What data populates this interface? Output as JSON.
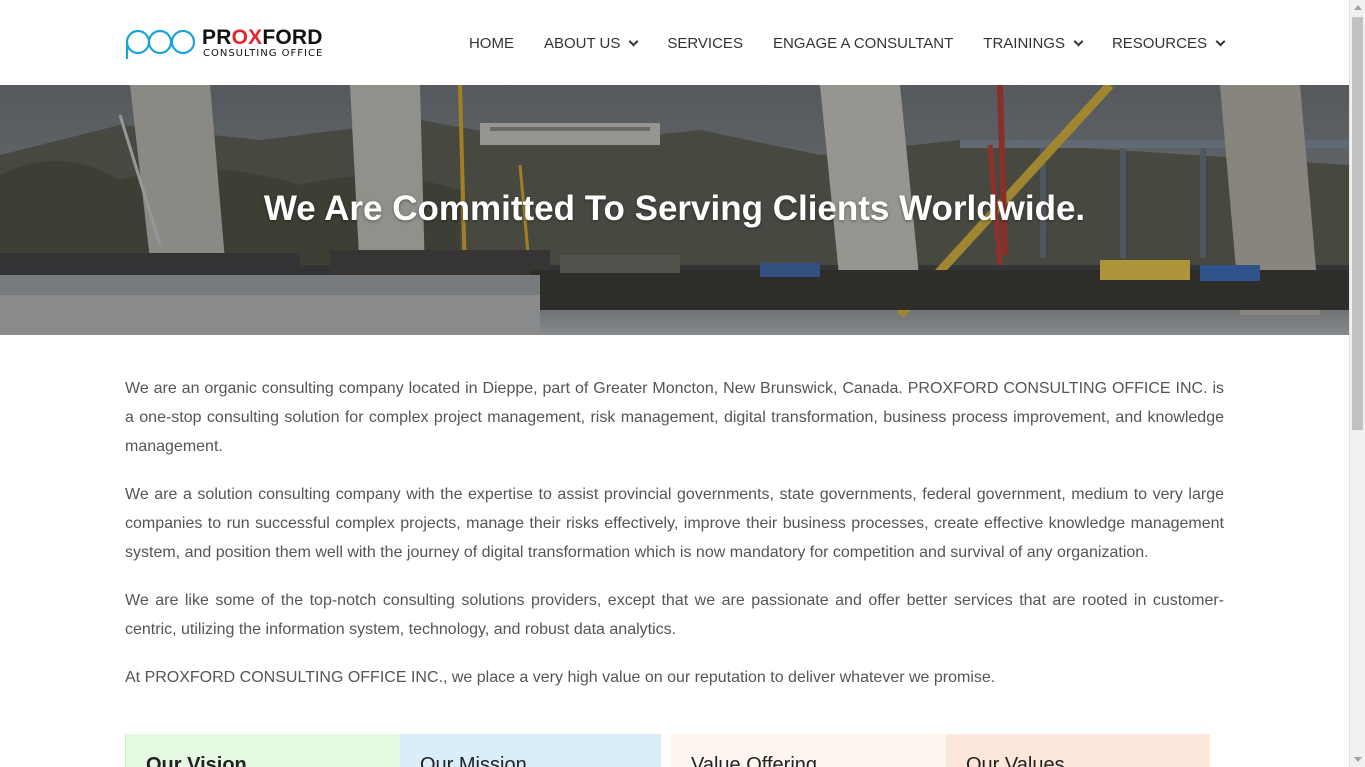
{
  "brand": {
    "name_part1": "PR",
    "name_accent": "OX",
    "name_part2": "FORD",
    "tagline": "CONSULTING OFFICE",
    "accent_color": "#e3262b",
    "mark_color": "#1aa3d9"
  },
  "nav": {
    "items": [
      {
        "label": "HOME",
        "has_dropdown": false
      },
      {
        "label": "ABOUT US",
        "has_dropdown": true
      },
      {
        "label": "SERVICES",
        "has_dropdown": false
      },
      {
        "label": "ENGAGE A CONSULTANT",
        "has_dropdown": false
      },
      {
        "label": "TRAININGS",
        "has_dropdown": true
      },
      {
        "label": "RESOURCES",
        "has_dropdown": true
      }
    ]
  },
  "hero": {
    "title": "We Are Committed To Serving Clients Worldwide."
  },
  "content": {
    "paragraphs": [
      "We are an organic consulting company located in Dieppe, part of Greater Moncton, New Brunswick, Canada. PROXFORD CONSULTING OFFICE INC. is a one-stop consulting solution for complex project management, risk management, digital transformation, business process improvement, and knowledge management.",
      "We are a solution consulting company with the expertise to assist provincial governments, state governments, federal government, medium to very large companies to run successful complex projects, manage their risks effectively, improve their business processes, create effective knowledge management system, and position them well with the journey of digital transformation which is now mandatory for competition and survival of any organization.",
      "We are like some of the top-notch consulting solutions providers, except that we are passionate and offer better services that are rooted in customer-centric, utilizing the information system, technology, and robust data analytics.",
      "At PROXFORD CONSULTING OFFICE INC., we place a very high value on our reputation to deliver whatever we promise."
    ]
  },
  "cards": [
    {
      "title": "Our Vision",
      "color": "#e5f8e2"
    },
    {
      "title": "Our Mission",
      "color": "#daeef9"
    },
    {
      "title": "Value Offering",
      "color": "#fdf6ee"
    },
    {
      "title": "Our Values",
      "color": "#fde6da"
    }
  ]
}
